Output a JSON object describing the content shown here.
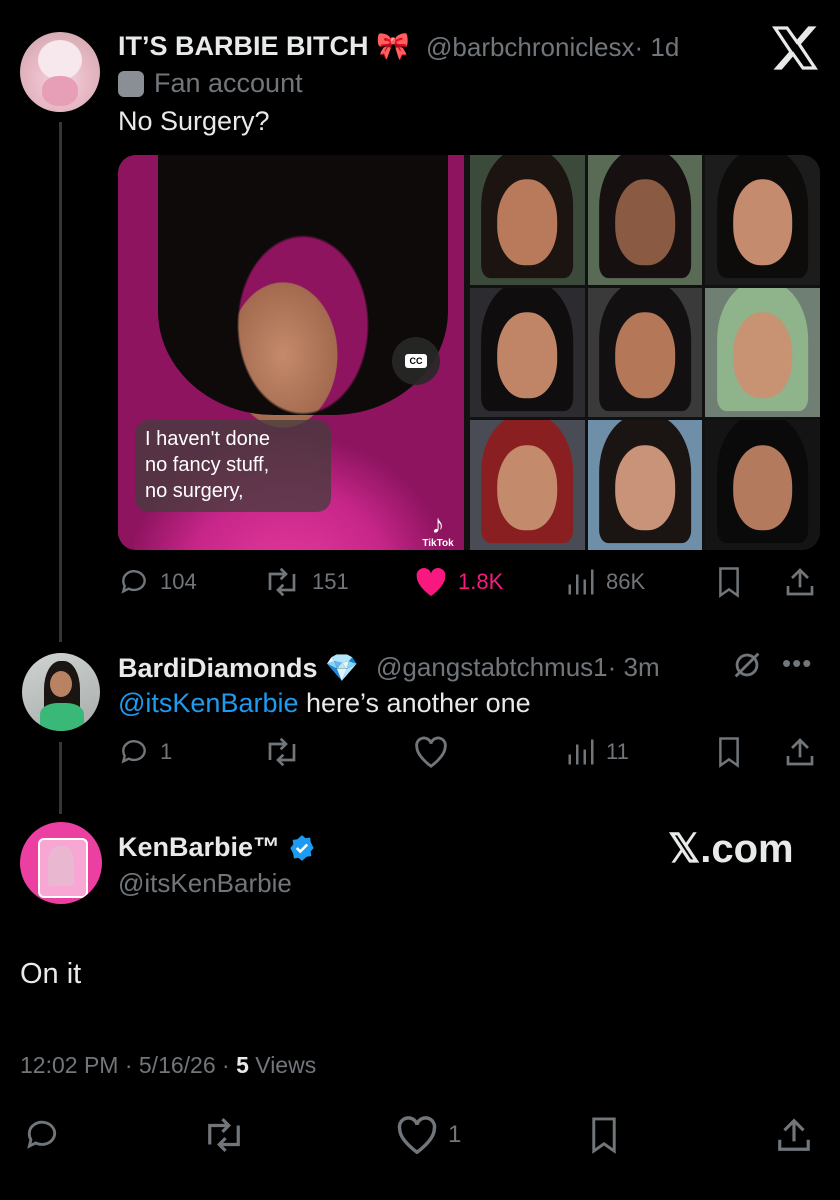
{
  "colors": {
    "background": "#000000",
    "text": "#e7e9ea",
    "muted": "#71767b",
    "link": "#1d9bf0",
    "like": "#f91880",
    "verified": "#1d9bf0"
  },
  "quoted_tweet_1": {
    "name": "IT’S BARBIE BITCH",
    "name_emoji": "🎀",
    "handle": "@barbchroniclesx",
    "time": "· 1d",
    "label_icon": "theater-masks-icon",
    "label": "Fan account",
    "text": "No Surgery?",
    "media": {
      "video_caption_lines": [
        "I haven't done",
        "no fancy stuff,",
        "no surgery,"
      ],
      "cc_label": "CC",
      "watermark": "TikTok"
    },
    "actions": {
      "replies": "104",
      "reposts": "151",
      "likes": "1.8K",
      "views": "86K"
    }
  },
  "quoted_tweet_2": {
    "name": "BardiDiamonds",
    "name_emoji": "💎",
    "handle": "@gangstabtchmus1",
    "time": "· 3m",
    "mention": "@itsKenBarbie",
    "text": " here’s another one",
    "actions": {
      "replies": "1",
      "views": "11"
    }
  },
  "main_tweet": {
    "name": "KenBarbie™",
    "handle": "@itsKenBarbie",
    "text": "On it",
    "timestamp": "12:02 PM · 5/16/26 · ",
    "views_count": "5",
    "views_label": " Views",
    "actions": {
      "likes": "1"
    }
  },
  "branding": {
    "x_logo_top": "𝕏",
    "x_com": "𝕏.com"
  }
}
